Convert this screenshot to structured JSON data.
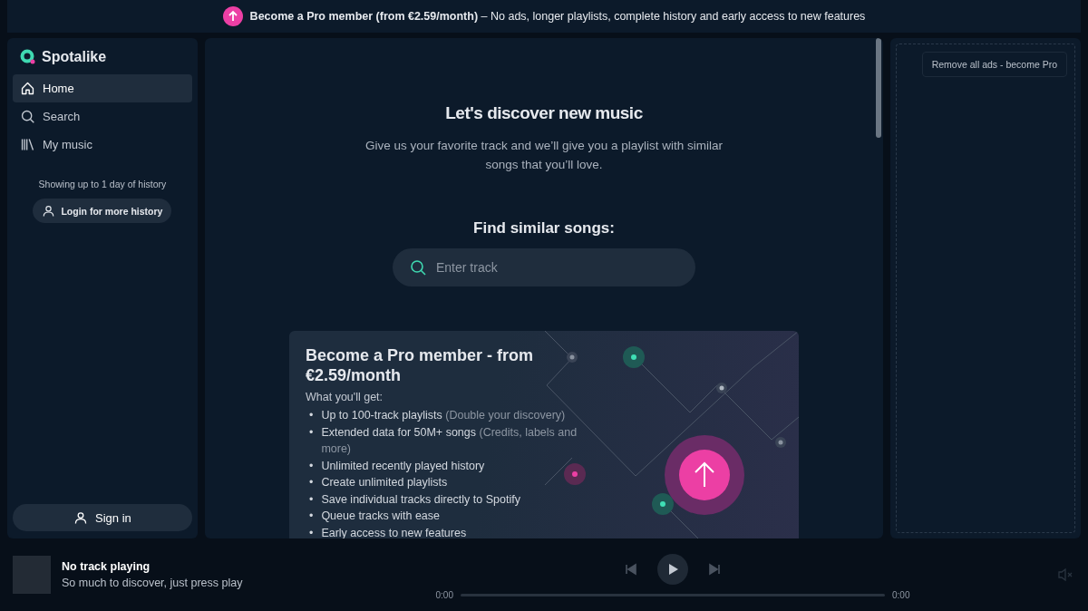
{
  "banner": {
    "bold": "Become a Pro member (from €2.59/month)",
    "text": " – No ads, longer playlists, complete history and early access to new features"
  },
  "sidebar": {
    "logo": "Spotalike",
    "items": [
      {
        "label": "Home",
        "selected": true
      },
      {
        "label": "Search",
        "selected": false
      },
      {
        "label": "My music",
        "selected": false
      }
    ],
    "history_note": "Showing up to 1 day of history",
    "login_button": "Login for more history",
    "sign_in": "Sign in"
  },
  "main": {
    "title": "Let's discover new music",
    "subtitle": "Give us your favorite track and we’ll give you a playlist with similar songs that you’ll love.",
    "find_label": "Find similar songs:",
    "search": {
      "placeholder": "Enter track"
    },
    "promo": {
      "bullet": "•",
      "title": "Become a Pro member - from €2.59/month",
      "intro": "What you'll get:",
      "benefits": [
        {
          "text": "Up to 100-track playlists",
          "note": "(Double your discovery)"
        },
        {
          "text": "Extended data for 50M+ songs",
          "note": "(Credits, labels and more)"
        },
        {
          "text": "Unlimited recently played history"
        },
        {
          "text": "Create unlimited playlists"
        },
        {
          "text": "Save individual tracks directly to Spotify"
        },
        {
          "text": "Queue tracks with ease"
        },
        {
          "text": "Early access to new features"
        }
      ]
    }
  },
  "right_panel": {
    "button": "Remove all ads - become Pro"
  },
  "player": {
    "title": "No track playing",
    "subtitle": "So much to discover, just press play",
    "elapsed": "0:00",
    "total": "0:00",
    "muted": true
  }
}
